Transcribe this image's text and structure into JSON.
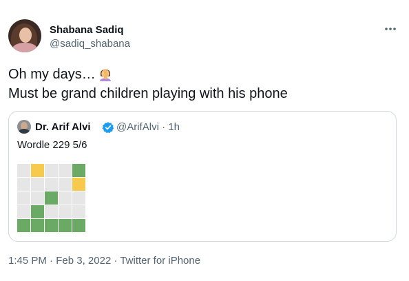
{
  "author": {
    "name": "Shabana Sadiq",
    "handle": "@sadiq_shabana"
  },
  "tweet": {
    "line1": "Oh my days…",
    "line2": "Must be grand children playing with his phone",
    "emoji": "facepalm-woman-icon"
  },
  "quoted": {
    "name": "Dr. Arif Alvi",
    "verified_icon": "verified-badge-icon",
    "handle_time": "@ArifAlvi · 1h",
    "text": "Wordle 229 5/6",
    "grid": [
      [
        "x",
        "y",
        "x",
        "x",
        "g"
      ],
      [
        "x",
        "x",
        "x",
        "x",
        "y"
      ],
      [
        "x",
        "x",
        "g",
        "x",
        "x"
      ],
      [
        "x",
        "g",
        "x",
        "x",
        "x"
      ],
      [
        "g",
        "g",
        "g",
        "g",
        "g"
      ]
    ]
  },
  "meta": {
    "time": "1:45 PM",
    "sep1": " · ",
    "date": "Feb 3, 2022",
    "sep2": " · ",
    "source": "Twitter for iPhone"
  },
  "colors": {
    "green": "#6aaa64",
    "yellow": "#f7c94d",
    "empty": "#e6e6e6",
    "verified": "#1d9bf0"
  }
}
